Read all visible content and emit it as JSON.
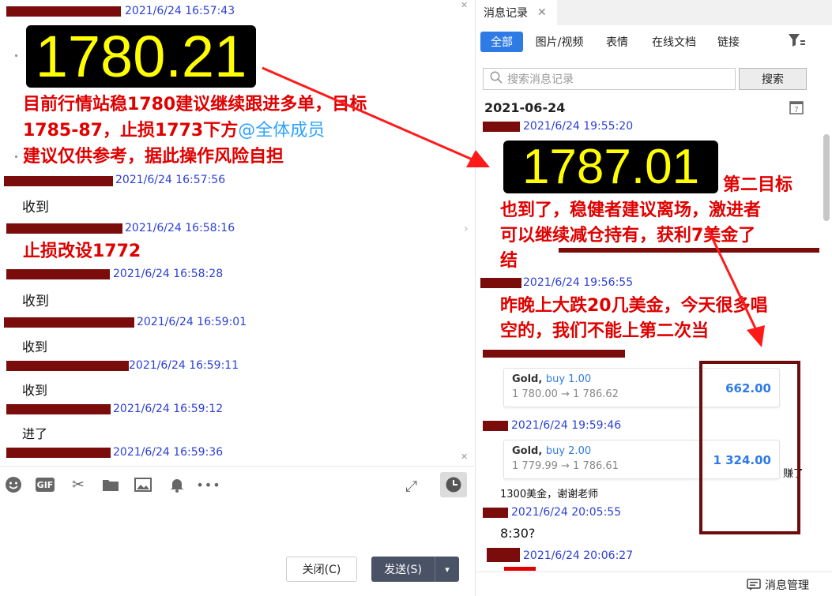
{
  "left_chat": {
    "messages": [
      {
        "time": "2021/6/24 16:57:43"
      },
      {
        "time": "2021/6/24 16:57:56",
        "text": "收到"
      },
      {
        "time": "2021/6/24 16:58:16",
        "text": "止损改设1772"
      },
      {
        "time": "2021/6/24 16:58:28",
        "text": "收到"
      },
      {
        "time": "2021/6/24 16:59:01",
        "text": "收到"
      },
      {
        "time": "2021/6/24 16:59:11",
        "text": "收到"
      },
      {
        "time": "2021/6/24 16:59:12",
        "text": "进了"
      },
      {
        "time": "2021/6/24 16:59:36"
      }
    ],
    "price_image": "1780.21",
    "signal_text": {
      "line1": "目前行情站稳1780建议继续跟进多单，目标",
      "line2": "1785-87，止损1773下方",
      "mention": "@全体成员",
      "line3": "建议仅供参考，据此操作风险自担"
    },
    "close_label": "关闭(C)",
    "send_label": "发送(S)",
    "toolbar": [
      "emoji-icon",
      "gif-icon",
      "scissors-icon",
      "folder-icon",
      "image-icon",
      "bell-icon",
      "more-icon"
    ]
  },
  "history": {
    "tab_label": "消息记录",
    "filters": [
      "全部",
      "图片/视频",
      "表情",
      "在线文档",
      "链接"
    ],
    "search_placeholder": "搜索消息记录",
    "search_button": "搜索",
    "date": "2021-06-24",
    "messages": [
      {
        "time": "2021/6/24 19:55:20"
      },
      {
        "time": "2021/6/24 19:56:55"
      },
      {
        "time": "2021/6/24 19:59:46"
      },
      {
        "time": "2021/6/24 20:05:55",
        "text": "8:30?"
      },
      {
        "time": "2021/6/24 20:06:27"
      }
    ],
    "price_image": "1787.01",
    "target_text": {
      "line1": "第二目标",
      "line2": "也到了，稳健者建议离场，激进者",
      "line3": "可以继续减仓持有，获利7美金了",
      "line4": "结"
    },
    "drop_text": {
      "line1": "昨晚上大跌20几美金，今天很多唱",
      "line2": "空的，我们不能上第二次当"
    },
    "trade_cards": [
      {
        "symbol": "Gold,",
        "side": "buy 1.00",
        "prices": "1 780.00 → 1 786.62",
        "profit": "662.00"
      },
      {
        "symbol": "Gold,",
        "side": "buy 2.00",
        "prices": "1 779.99 → 1 786.61",
        "profit": "1 324.00"
      }
    ],
    "earn_label": "赚了",
    "thanks_text": "1300美金，谢谢老师",
    "manage_label": "消息管理"
  },
  "colors": {
    "accent": "#2f7be6",
    "annotation_red": "#e00000",
    "redaction": "#7a0c0c",
    "timestamp": "#2b3fd6",
    "price_yellow": "#ffff00"
  }
}
